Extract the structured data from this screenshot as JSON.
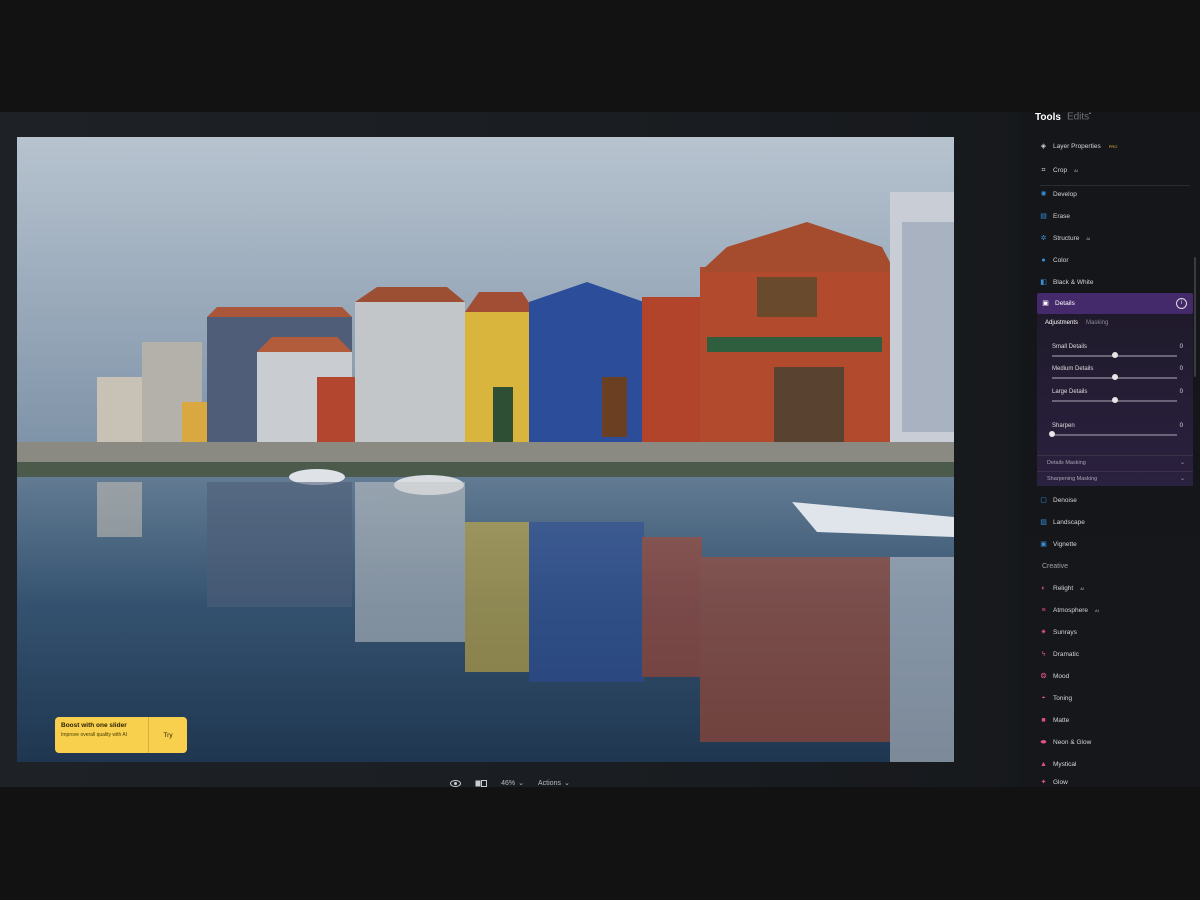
{
  "panel": {
    "tabs": {
      "tools": "Tools",
      "edits": "Edits",
      "edits_marker": "•"
    },
    "tools": [
      {
        "label": "Layer Properties",
        "badge": "PRO",
        "icon": "layers-icon"
      },
      {
        "label": "Crop",
        "badge": "AI",
        "icon": "crop-icon"
      }
    ],
    "essentials": [
      {
        "label": "Develop",
        "icon": "develop-icon"
      },
      {
        "label": "Erase",
        "icon": "erase-icon"
      },
      {
        "label": "Structure",
        "badge": "AI",
        "icon": "structure-icon"
      },
      {
        "label": "Color",
        "icon": "color-icon"
      },
      {
        "label": "Black & White",
        "icon": "black-white-icon"
      }
    ],
    "details": {
      "title": "Details",
      "subtabs": {
        "adjustments": "Adjustments",
        "masking": "Masking"
      },
      "sliders": [
        {
          "label": "Small Details",
          "value": "0",
          "level": 0.5
        },
        {
          "label": "Medium Details",
          "value": "0",
          "level": 0.5
        },
        {
          "label": "Large Details",
          "value": "0",
          "level": 0.5
        },
        {
          "label": "Sharpen",
          "value": "0",
          "level": 0.0
        }
      ],
      "details_masking": "Details Masking",
      "sharpening_masking": "Sharpening Masking"
    },
    "after_details": [
      {
        "label": "Denoise",
        "icon": "denoise-icon"
      },
      {
        "label": "Landscape",
        "icon": "landscape-icon"
      },
      {
        "label": "Vignette",
        "icon": "vignette-icon"
      }
    ],
    "creative_label": "Creative",
    "creative": [
      {
        "label": "Relight",
        "badge": "AI",
        "icon": "relight-icon"
      },
      {
        "label": "Atmosphere",
        "badge": "AI",
        "icon": "atmosphere-icon"
      },
      {
        "label": "Sunrays",
        "icon": "sunrays-icon"
      },
      {
        "label": "Dramatic",
        "icon": "dramatic-icon"
      },
      {
        "label": "Mood",
        "icon": "mood-icon"
      },
      {
        "label": "Toning",
        "icon": "toning-icon"
      },
      {
        "label": "Matte",
        "icon": "matte-icon"
      },
      {
        "label": "Neon & Glow",
        "icon": "neon-glow-icon"
      },
      {
        "label": "Mystical",
        "icon": "mystical-icon"
      },
      {
        "label": "Glow",
        "icon": "glow-icon"
      }
    ]
  },
  "promo": {
    "title": "Boost with one slider",
    "subtitle": "Improve overall quality with AI",
    "button": "Try"
  },
  "toolbar": {
    "zoom": "46%",
    "actions": "Actions"
  },
  "colors": {
    "accent": "#442a6b",
    "promo": "#f8d04d",
    "creative_icon": "#e0508a",
    "essential_icon": "#3a8fd9"
  }
}
